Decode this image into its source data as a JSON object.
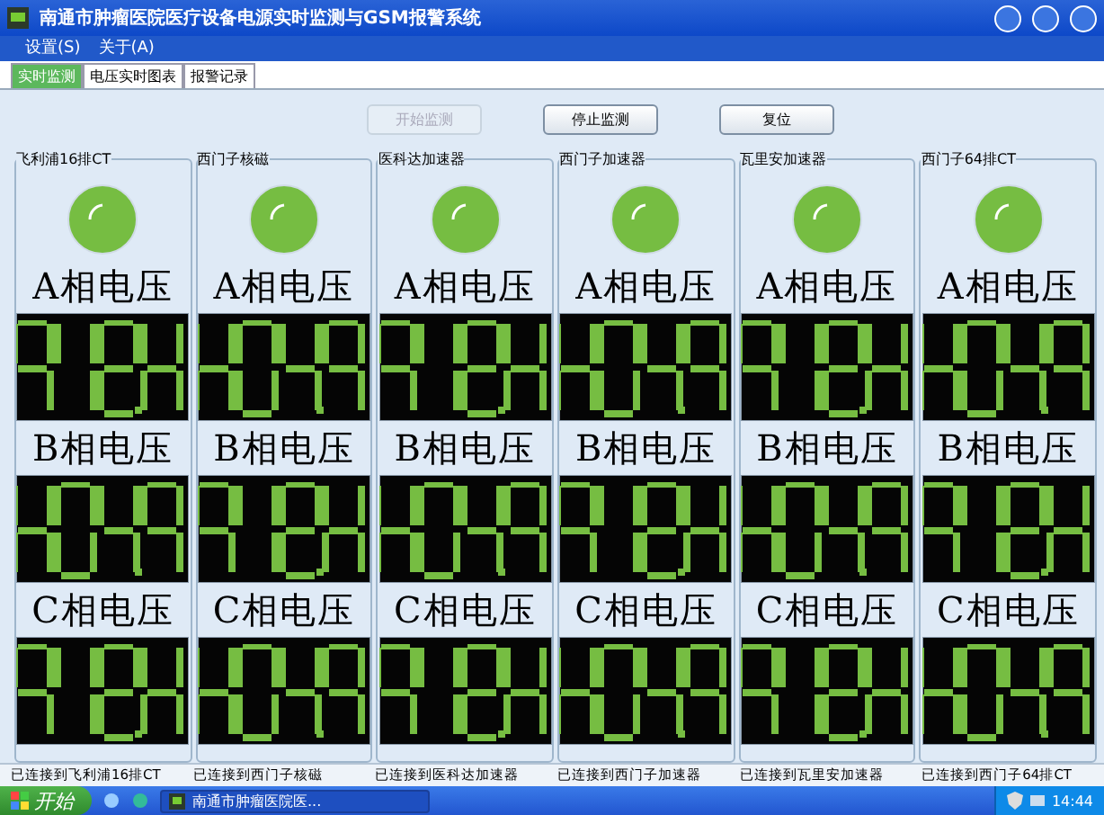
{
  "window": {
    "title": "南通市肿瘤医院医疗设备电源实时监测与GSM报警系统"
  },
  "menu": [
    "设置(S)",
    "关于(A)"
  ],
  "tabs": [
    {
      "label": "实时监测",
      "selected": true
    },
    {
      "label": "电压实时图表",
      "selected": false
    },
    {
      "label": "报警记录",
      "selected": false
    }
  ],
  "buttons": [
    {
      "label": "开始监测",
      "disabled": true
    },
    {
      "label": "停止监测",
      "disabled": false
    },
    {
      "label": "复位",
      "disabled": false
    }
  ],
  "devices": [
    {
      "name": "飞利浦16排CT",
      "lamp_on": true,
      "phases": [
        "A相电压",
        "B相电压",
        "C相电压"
      ]
    },
    {
      "name": "西门子核磁",
      "lamp_on": true,
      "phases": [
        "A相电压",
        "B相电压",
        "C相电压"
      ]
    },
    {
      "name": "医科达加速器",
      "lamp_on": true,
      "phases": [
        "A相电压",
        "B相电压",
        "C相电压"
      ]
    },
    {
      "name": "西门子加速器",
      "lamp_on": true,
      "phases": [
        "A相电压",
        "B相电压",
        "C相电压"
      ]
    },
    {
      "name": "瓦里安加速器",
      "lamp_on": true,
      "phases": [
        "A相电压",
        "B相电压",
        "C相电压"
      ]
    },
    {
      "name": "西门子64排CT",
      "lamp_on": true,
      "phases": [
        "A相电压",
        "B相电压",
        "C相电压"
      ]
    }
  ],
  "status_bar": [
    "已连接到飞利浦16排CT",
    "已连接到西门子核磁",
    "已连接到医科达加速器",
    "已连接到西门子加速器",
    "已连接到瓦里安加速器",
    "已连接到西门子64排CT"
  ],
  "taskbar": {
    "start": "开始",
    "task": "南通市肿瘤医院医...",
    "clock": "14:44"
  }
}
